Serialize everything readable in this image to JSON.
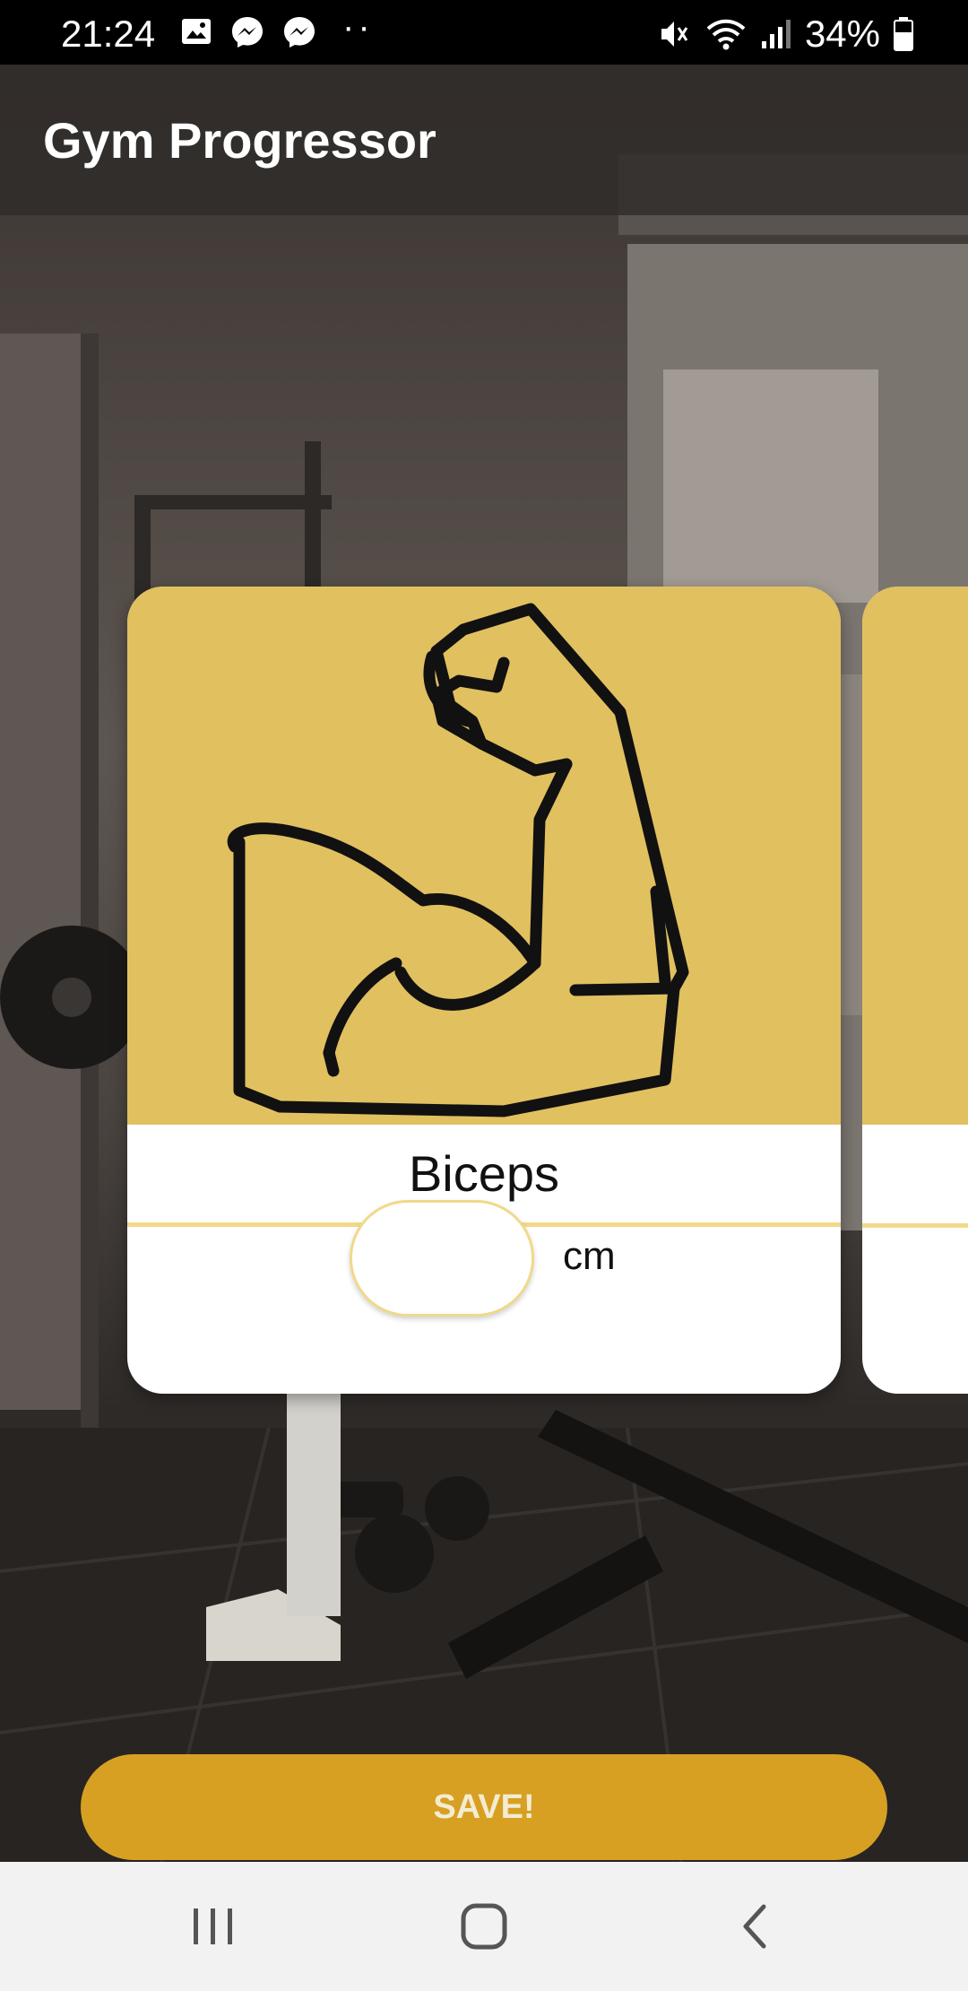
{
  "status_bar": {
    "time": "21:24",
    "battery": "34%",
    "icons": [
      "image-icon",
      "messenger-icon",
      "messenger-icon",
      "more-dots-icon",
      "mute-icon",
      "wifi-icon",
      "signal-icon",
      "battery-icon"
    ],
    "dots": "··"
  },
  "app_bar": {
    "title": "Gym Progressor"
  },
  "card": {
    "icon": "flexed-bicep-icon",
    "label": "Biceps",
    "input_value": "",
    "unit": "cm"
  },
  "save_button": {
    "label": "SAVE!"
  },
  "colors": {
    "accent": "#d7a022",
    "accent_light": "#f1d98a"
  },
  "nav_bar": {
    "icons": [
      "recent-apps-icon",
      "home-icon",
      "back-icon"
    ]
  }
}
